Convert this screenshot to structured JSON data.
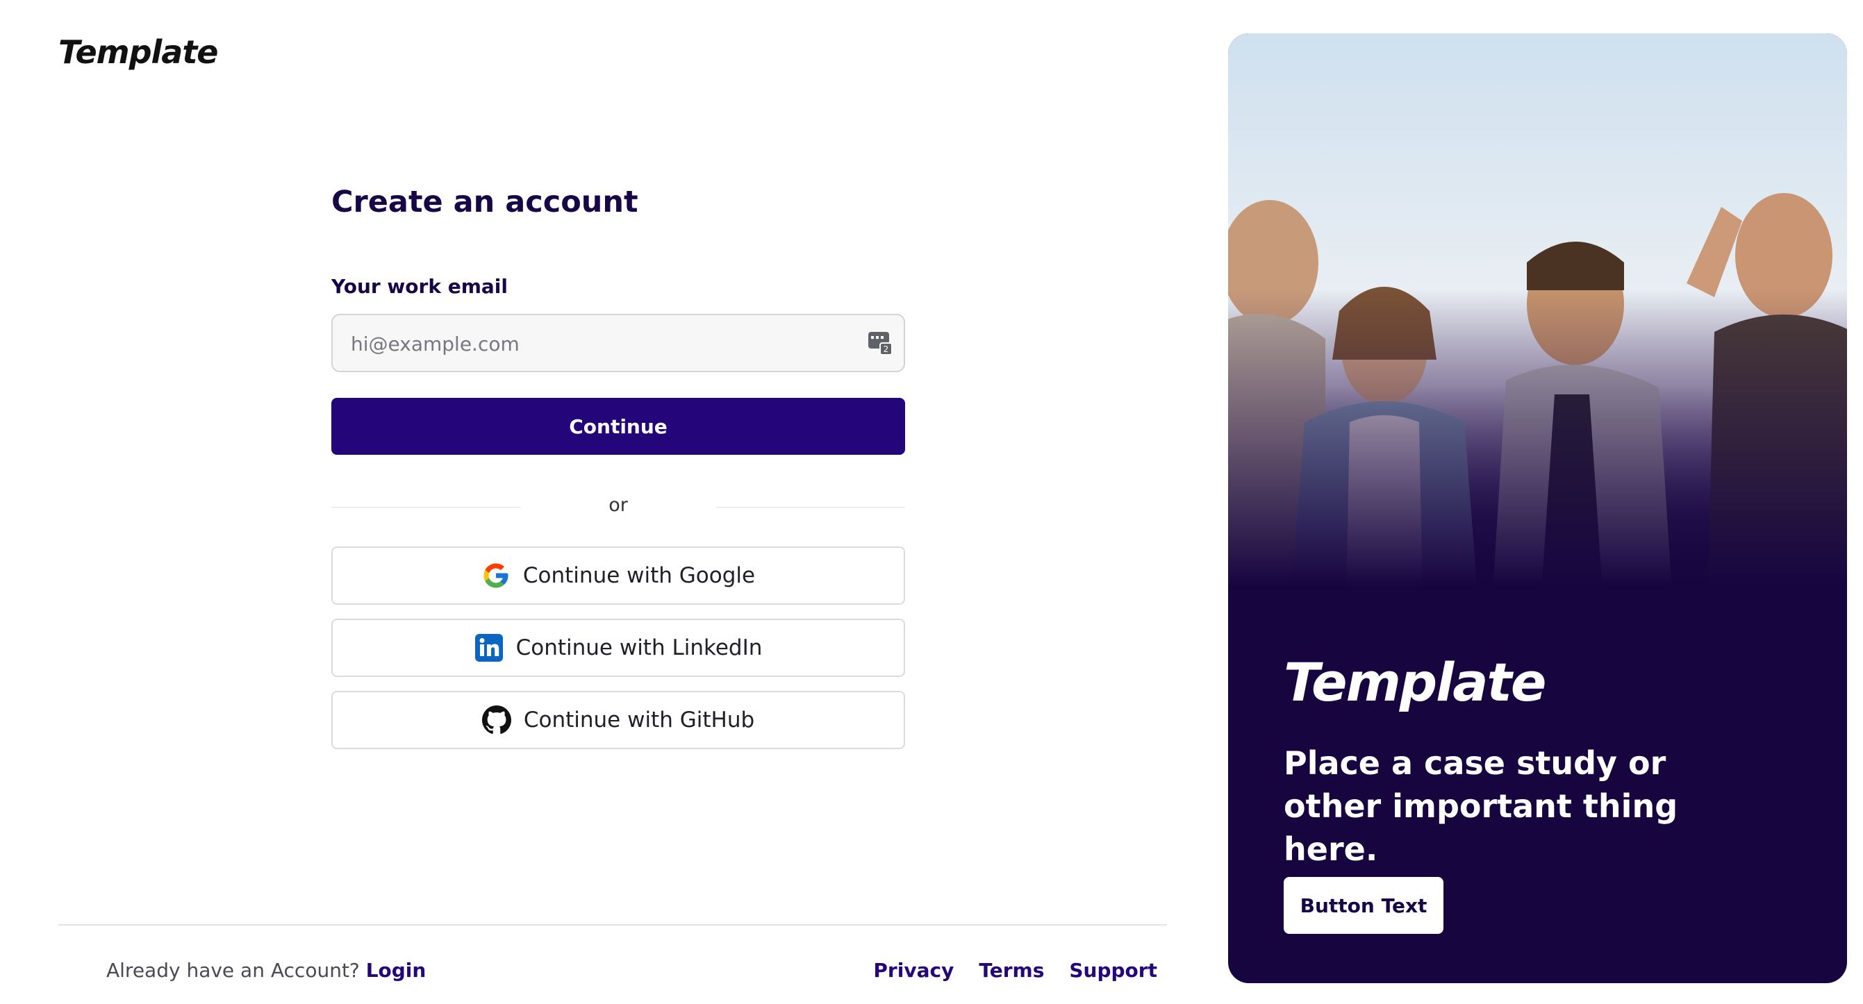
{
  "brand": {
    "logo_text": "Template"
  },
  "form": {
    "title": "Create an account",
    "email_label": "Your work email",
    "email_placeholder": "hi@example.com",
    "email_value": "",
    "continue_label": "Continue",
    "divider_text": "or",
    "social": [
      {
        "label": "Continue with Google",
        "icon": "google-icon"
      },
      {
        "label": "Continue with LinkedIn",
        "icon": "linkedin-icon"
      },
      {
        "label": "Continue with GitHub",
        "icon": "github-icon"
      }
    ]
  },
  "footer": {
    "account_prompt": "Already have an Account?",
    "login_link": "Login",
    "links": [
      "Privacy",
      "Terms",
      "Support"
    ]
  },
  "promo": {
    "logo_text": "Template",
    "text": "Place a case study or other important thing here.",
    "button_label": "Button Text"
  },
  "colors": {
    "primary": "#25067a",
    "promo_bg": "#170540",
    "heading": "#170746"
  }
}
